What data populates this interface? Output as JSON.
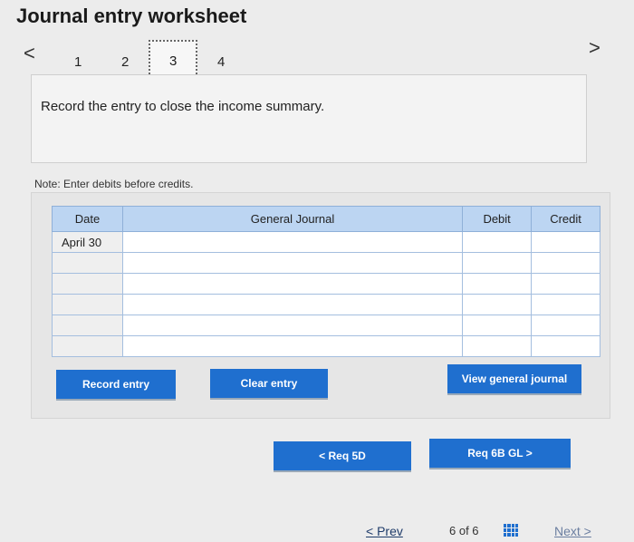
{
  "title": "Journal entry worksheet",
  "pager": {
    "prev_arrow": "<",
    "next_arrow": ">",
    "pages": [
      "1",
      "2",
      "3",
      "4"
    ],
    "current": "3"
  },
  "prompt": "Record the entry to close the income summary.",
  "note": "Note: Enter debits before credits.",
  "journal": {
    "headers": [
      "Date",
      "General Journal",
      "Debit",
      "Credit"
    ],
    "rows": [
      {
        "date": "April 30",
        "account": "",
        "debit": "",
        "credit": ""
      },
      {
        "date": "",
        "account": "",
        "debit": "",
        "credit": ""
      },
      {
        "date": "",
        "account": "",
        "debit": "",
        "credit": ""
      },
      {
        "date": "",
        "account": "",
        "debit": "",
        "credit": ""
      },
      {
        "date": "",
        "account": "",
        "debit": "",
        "credit": ""
      },
      {
        "date": "",
        "account": "",
        "debit": "",
        "credit": ""
      }
    ]
  },
  "buttons": {
    "record": "Record entry",
    "clear": "Clear entry",
    "view": "View general journal",
    "prev_req": "< Req 5D",
    "next_req": "Req 6B GL >"
  },
  "footer": {
    "prev": "< Prev",
    "count": "6 of 6",
    "next": "Next >"
  },
  "colors": {
    "primary_button": "#1f6fcf",
    "table_header": "#bcd5f2"
  }
}
